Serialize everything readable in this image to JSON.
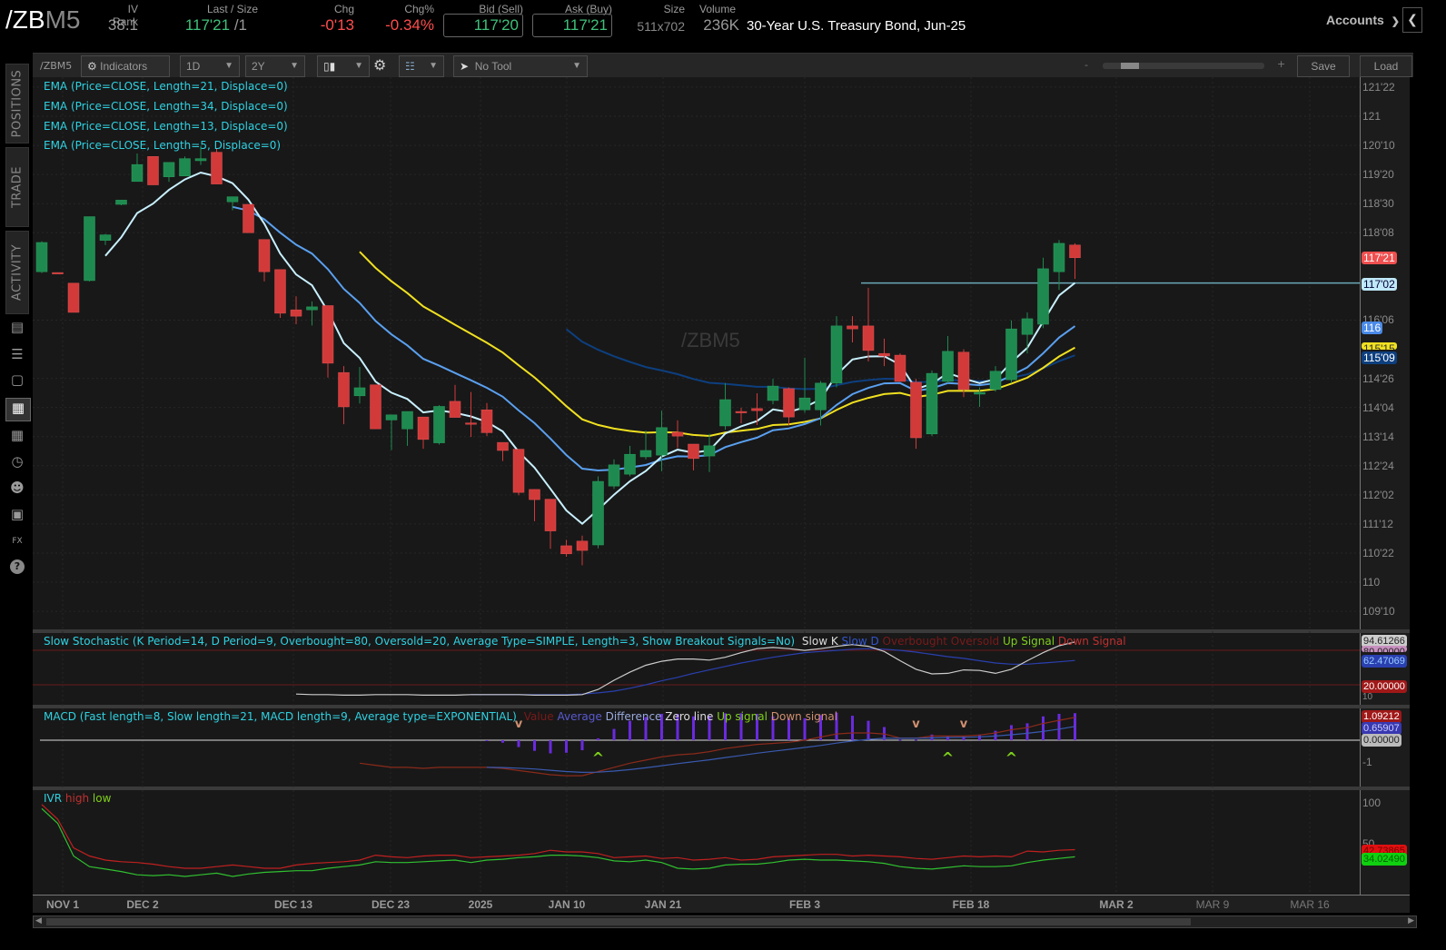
{
  "header": {
    "symbol_prefix": "/ZB",
    "symbol_suffix": "M5",
    "iv_rank_label": "IV Rank",
    "iv_rank": "38.1",
    "last_label": "Last / Size",
    "last": "117'21",
    "last_size": "/1",
    "chg_label": "Chg",
    "chg": "-0'13",
    "chgpct_label": "Chg%",
    "chgpct": "-0.34%",
    "bid_label": "Bid (Sell)",
    "bid": "117'20",
    "ask_label": "Ask (Buy)",
    "ask": "117'21",
    "size_label": "Size",
    "size": "511x702",
    "volume_label": "Volume",
    "volume": "236K",
    "description": "30-Year U.S. Treasury Bond, Jun-25",
    "accounts_label": "Accounts"
  },
  "toolbar": {
    "symbol": "/ZBM5",
    "indicators_label": "Indicators",
    "aggregation": "1D",
    "timeframe": "2Y",
    "drawing_tool": "No Tool",
    "zoom_minus": "-",
    "zoom_plus": "+",
    "zoom_level": 0.15,
    "save_label": "Save",
    "load_label": "Load"
  },
  "sidebar": {
    "tabs": [
      "POSITIONS",
      "TRADE",
      "ACTIVITY"
    ],
    "icons": [
      "chart-summary-icon",
      "list-icon",
      "tv-icon",
      "chart-icon",
      "grid-icon",
      "clock-icon",
      "community-icon",
      "calendar-icon",
      "fx-icon",
      "help-icon"
    ]
  },
  "chart": {
    "watermark": "/ZBM5",
    "ema_legends": [
      "EMA (Price=CLOSE, Length=21, Displace=0)",
      "EMA (Price=CLOSE, Length=34, Displace=0)",
      "EMA (Price=CLOSE, Length=13, Displace=0)",
      "EMA (Price=CLOSE, Length=5, Displace=0)"
    ],
    "price_ticks": [
      "121'22",
      "121",
      "120'10",
      "119'20",
      "118'30",
      "118'08",
      "116'06",
      "114'26",
      "114'04",
      "113'14",
      "112'24",
      "112'02",
      "111'12",
      "110'22",
      "110",
      "109'10"
    ],
    "price_tags": {
      "last": "117'21",
      "line": "117'02",
      "ema13": "116",
      "ema21": "115'15",
      "ema34": "115'09"
    },
    "x_labels": [
      "NOV 1",
      "DEC 2",
      "DEC 13",
      "DEC 23",
      "2025",
      "JAN 10",
      "JAN 21",
      "FEB 3",
      "FEB 18",
      "MAR 2",
      "MAR 9",
      "MAR 16"
    ],
    "horizontal_line_price": 117.0625,
    "colors": {
      "up": "#1e8a4f",
      "down": "#d23a3a",
      "ema5": "#c8f0ff",
      "ema13": "#5aa0f0",
      "ema21": "#f0e020",
      "ema34": "#0d3f7f"
    }
  },
  "stochastic": {
    "legend": "Slow Stochastic (K Period=14, D Period=9, Overbought=80, Oversold=20, Average Type=SIMPLE, Length=3, Show Breakout Signals=No)",
    "keys": [
      "Slow K",
      "Slow D",
      "Overbought",
      "Oversold",
      "Up Signal",
      "Down Signal"
    ],
    "tags": {
      "k": "94.61266",
      "ob": "80.00000",
      "d": "62.47069",
      "os": "20.00000",
      "tick": "10"
    }
  },
  "macd": {
    "legend": "MACD (Fast length=8, Slow length=21, MACD length=9, Average type=EXPONENTIAL)",
    "keys": [
      "Value",
      "Average",
      "Difference",
      "Zero line",
      "Up signal",
      "Down signal"
    ],
    "tags": {
      "value": "1.09212",
      "avg": "0.65907",
      "zero": "0.00000",
      "tick": "-1"
    }
  },
  "ivr": {
    "keys": [
      "IVR",
      "high",
      "low"
    ],
    "tags": {
      "t100": "100",
      "t50": "50",
      "high": "42.73865",
      "low": "34.02490"
    }
  },
  "chart_data": {
    "type": "candlestick",
    "title": "/ZBM5 daily",
    "ylim": [
      109,
      122
    ],
    "candles_ohlc": [
      [
        117.33,
        118.05,
        117.3,
        118.02
      ],
      [
        117.31,
        117.31,
        117.3,
        117.3
      ],
      [
        117.06,
        117.06,
        116.37,
        116.37
      ],
      [
        117.12,
        118.63,
        117.1,
        118.63
      ],
      [
        118.07,
        118.22,
        117.96,
        118.2
      ],
      [
        118.92,
        119.02,
        118.9,
        119.02
      ],
      [
        119.46,
        120.12,
        119.46,
        119.86
      ],
      [
        120.05,
        120.05,
        119.38,
        119.38
      ],
      [
        119.57,
        119.91,
        119.45,
        119.91
      ],
      [
        119.59,
        120.05,
        119.59,
        120.0
      ],
      [
        119.95,
        120.3,
        119.85,
        120.0
      ],
      [
        120.15,
        120.25,
        119.4,
        119.4
      ],
      [
        118.98,
        119.1,
        118.78,
        119.1
      ],
      [
        118.92,
        118.92,
        118.25,
        118.25
      ],
      [
        118.09,
        118.09,
        117.1,
        117.33
      ],
      [
        117.38,
        117.38,
        116.24,
        116.35
      ],
      [
        116.43,
        116.75,
        116.09,
        116.28
      ],
      [
        116.43,
        116.63,
        116.06,
        116.5
      ],
      [
        116.53,
        116.53,
        114.83,
        115.17
      ],
      [
        114.95,
        115.1,
        113.73,
        114.14
      ],
      [
        114.4,
        115.08,
        114.22,
        114.59
      ],
      [
        114.66,
        114.66,
        113.62,
        113.62
      ],
      [
        113.83,
        113.95,
        113.12,
        113.95
      ],
      [
        113.62,
        114.03,
        113.22,
        114.03
      ],
      [
        113.9,
        113.9,
        113.15,
        113.37
      ],
      [
        113.29,
        114.18,
        113.25,
        114.15
      ],
      [
        114.27,
        114.66,
        113.89,
        113.89
      ],
      [
        113.76,
        114.49,
        113.43,
        113.74
      ],
      [
        114.07,
        114.23,
        113.45,
        113.53
      ],
      [
        113.3,
        113.3,
        112.86,
        113.11
      ],
      [
        113.14,
        113.14,
        112.05,
        112.12
      ],
      [
        112.19,
        112.19,
        111.44,
        111.95
      ],
      [
        111.96,
        111.96,
        110.79,
        111.21
      ],
      [
        110.86,
        111.0,
        110.6,
        110.67
      ],
      [
        110.97,
        111.1,
        110.4,
        110.75
      ],
      [
        110.88,
        112.5,
        110.8,
        112.38
      ],
      [
        112.27,
        112.9,
        112.2,
        112.77
      ],
      [
        112.55,
        113.22,
        112.5,
        113.02
      ],
      [
        112.96,
        113.58,
        112.9,
        113.11
      ],
      [
        113.0,
        114.05,
        112.62,
        113.65
      ],
      [
        113.54,
        113.82,
        113.17,
        113.45
      ],
      [
        113.26,
        113.26,
        112.64,
        112.92
      ],
      [
        112.98,
        113.5,
        112.6,
        113.22
      ],
      [
        113.69,
        114.7,
        113.6,
        114.31
      ],
      [
        114.03,
        114.12,
        113.75,
        114.02
      ],
      [
        114.1,
        114.46,
        113.71,
        114.05
      ],
      [
        114.29,
        114.8,
        114.2,
        114.63
      ],
      [
        114.57,
        114.6,
        113.71,
        113.9
      ],
      [
        114.07,
        115.3,
        114.0,
        114.35
      ],
      [
        114.07,
        114.75,
        113.7,
        114.7
      ],
      [
        114.7,
        116.28,
        114.6,
        116.05
      ],
      [
        116.05,
        116.28,
        115.66,
        115.98
      ],
      [
        116.05,
        116.95,
        115.21,
        115.47
      ],
      [
        115.4,
        115.75,
        115.1,
        115.34
      ],
      [
        115.36,
        115.4,
        114.74,
        114.74
      ],
      [
        114.72,
        114.8,
        113.15,
        113.41
      ],
      [
        113.5,
        115.0,
        113.45,
        114.93
      ],
      [
        114.74,
        115.81,
        114.7,
        115.45
      ],
      [
        115.43,
        115.5,
        114.37,
        114.55
      ],
      [
        114.44,
        114.6,
        114.14,
        114.48
      ],
      [
        114.55,
        115.1,
        114.5,
        114.98
      ],
      [
        114.78,
        116.18,
        114.7,
        115.98
      ],
      [
        115.85,
        116.37,
        115.4,
        116.22
      ],
      [
        116.09,
        117.66,
        116.0,
        117.4
      ],
      [
        117.33,
        118.08,
        116.9,
        118.0
      ],
      [
        117.96,
        118.0,
        117.16,
        117.66
      ]
    ],
    "ema_lengths": [
      5,
      13,
      21,
      34
    ],
    "stoch_k": {
      "start": 16,
      "values": [
        4,
        3,
        3,
        2,
        2,
        3,
        3,
        3,
        2,
        2,
        2,
        3,
        3,
        3,
        3,
        2,
        2,
        2,
        3,
        12,
        28,
        42,
        54,
        61,
        65,
        65,
        63,
        68,
        76,
        83,
        85,
        83,
        80,
        83,
        87,
        90,
        87,
        78,
        62,
        47,
        39,
        40,
        46,
        45,
        40,
        47,
        62,
        76,
        88,
        94.61
      ]
    },
    "stoch_d": {
      "start": 27,
      "values": [
        3,
        3,
        3,
        3,
        3,
        3,
        3,
        4,
        6,
        9,
        14,
        20,
        27,
        33,
        40,
        46,
        52,
        58,
        63,
        68,
        72,
        76,
        78,
        80,
        82,
        83,
        82,
        80,
        77,
        73,
        69,
        66,
        62,
        58,
        56,
        56,
        58,
        60,
        62.47
      ]
    },
    "stoch_levels": {
      "overbought": 80,
      "oversold": 20
    },
    "macd_value": {
      "start": 20,
      "values": [
        -1.1,
        -1.2,
        -1.3,
        -1.3,
        -1.35,
        -1.3,
        -1.3,
        -1.3,
        -1.3,
        -1.35,
        -1.45,
        -1.55,
        -1.65,
        -1.7,
        -1.7,
        -1.5,
        -1.3,
        -1.1,
        -0.95,
        -0.8,
        -0.7,
        -0.65,
        -0.55,
        -0.4,
        -0.3,
        -0.2,
        -0.15,
        -0.1,
        0.0,
        0.15,
        0.3,
        0.35,
        0.35,
        0.3,
        0.1,
        0.1,
        0.2,
        0.2,
        0.2,
        0.25,
        0.35,
        0.5,
        0.6,
        0.8,
        0.95,
        1.09
      ]
    },
    "macd_avg": {
      "start": 28,
      "values": [
        -1.3,
        -1.31,
        -1.34,
        -1.38,
        -1.44,
        -1.5,
        -1.54,
        -1.53,
        -1.48,
        -1.41,
        -1.32,
        -1.22,
        -1.12,
        -1.03,
        -0.94,
        -0.83,
        -0.73,
        -0.62,
        -0.53,
        -0.44,
        -0.35,
        -0.25,
        -0.14,
        -0.04,
        0.04,
        0.09,
        0.09,
        0.09,
        0.11,
        0.13,
        0.14,
        0.16,
        0.2,
        0.26,
        0.33,
        0.42,
        0.53,
        0.659
      ]
    },
    "macd_up_signals": [
      35,
      57,
      61
    ],
    "macd_down_signals": [
      30,
      55,
      58
    ],
    "ivr_high": [
      98,
      80,
      45,
      35,
      30,
      28,
      27,
      25,
      22,
      20,
      20,
      22,
      24,
      22,
      20,
      20,
      24,
      26,
      27,
      28,
      30,
      36,
      34,
      33,
      35,
      36,
      36,
      33,
      34,
      35,
      36,
      38,
      42,
      40,
      40,
      38,
      33,
      34,
      35,
      32,
      33,
      30,
      31,
      33,
      30,
      31,
      34,
      35,
      36,
      37,
      37,
      35,
      36,
      35,
      34,
      32,
      31,
      33,
      35,
      34,
      35,
      34,
      41,
      40,
      42,
      42.74
    ],
    "ivr_low": [
      93,
      75,
      35,
      22,
      19,
      16,
      12,
      11,
      12,
      10,
      12,
      14,
      10,
      13,
      15,
      16,
      17,
      17,
      20,
      22,
      24,
      28,
      27,
      27,
      28,
      29,
      30,
      27,
      30,
      31,
      33,
      34,
      36,
      36,
      35,
      33,
      29,
      28,
      30,
      27,
      20,
      19,
      20,
      24,
      25,
      25,
      27,
      30,
      31,
      30,
      30,
      29,
      28,
      26,
      22,
      20,
      19,
      21,
      23,
      22,
      22,
      23,
      27,
      30,
      32,
      34.02
    ]
  }
}
